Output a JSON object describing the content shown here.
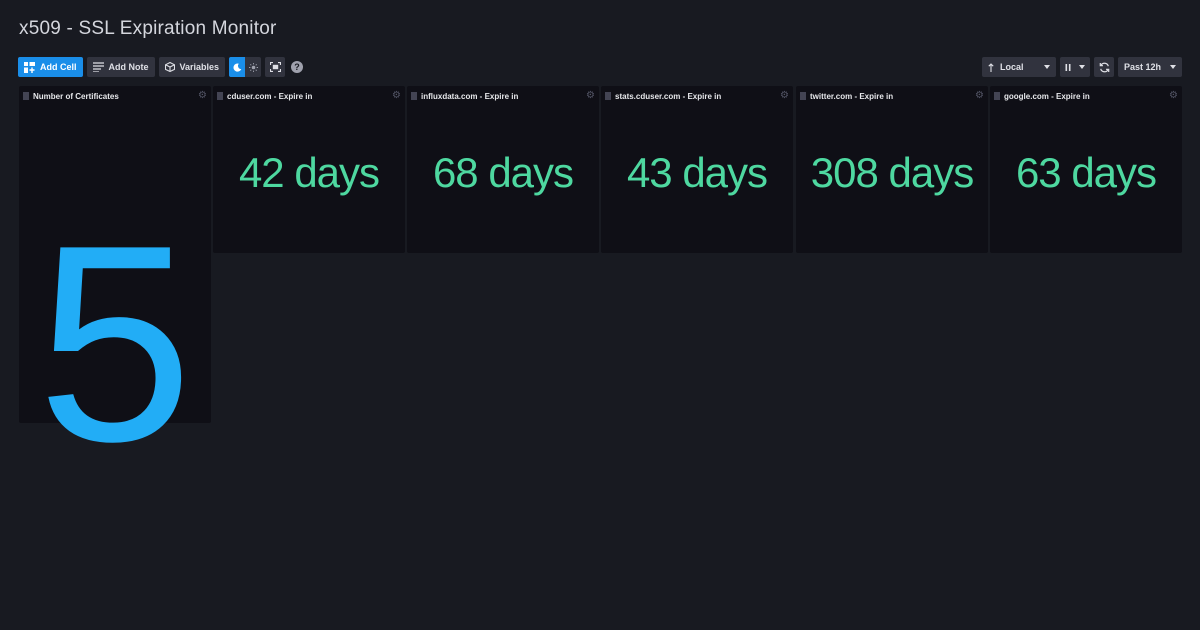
{
  "dashboard": {
    "title": "x509 - SSL Expiration Monitor"
  },
  "toolbar": {
    "add_cell": "Add Cell",
    "add_note": "Add Note",
    "variables": "Variables",
    "help": "?",
    "timezone": "Local",
    "time_range": "Past 12h"
  },
  "cells": [
    {
      "name": "Number of Certificates",
      "value": "5"
    },
    {
      "name": "cduser.com - Expire in",
      "value": "42 days"
    },
    {
      "name": "influxdata.com - Expire in",
      "value": "68 days"
    },
    {
      "name": "stats.cduser.com - Expire in",
      "value": "43 days"
    },
    {
      "name": "twitter.com - Expire in",
      "value": "308 days"
    },
    {
      "name": "google.com - Expire in",
      "value": "63 days"
    }
  ],
  "colors": {
    "background": "#181a21",
    "cell": "#0f0f16",
    "accent": "#1a8ee9",
    "big_value": "#22adf6",
    "value": "#4ed8a0"
  }
}
